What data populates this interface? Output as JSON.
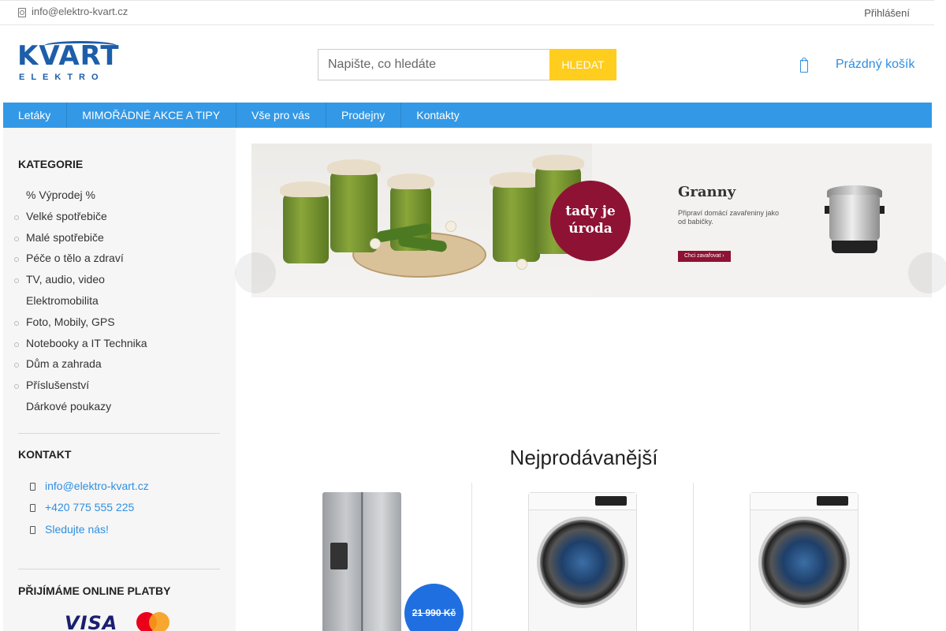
{
  "topbar": {
    "email": "info@elektro-kvart.cz",
    "login": "Přihlášení"
  },
  "logo": {
    "word": "KVART",
    "sub": "ELEKTRO"
  },
  "search": {
    "placeholder": "Napište, co hledáte",
    "button": "HLEDAT"
  },
  "cart": {
    "label": "Prázdný košík"
  },
  "nav": {
    "items": [
      "Letáky",
      "MIMOŘÁDNÉ AKCE A TIPY",
      "Vše pro vás",
      "Prodejny",
      "Kontakty"
    ]
  },
  "sidebar": {
    "categories_title": "KATEGORIE",
    "categories": [
      "% Výprodej %",
      "Velké spotřebiče",
      "Malé spotřebiče",
      "Péče o tělo a zdraví",
      "TV, audio, video",
      "Elektromobilita",
      "Foto, Mobily, GPS",
      "Notebooky a IT Technika",
      "Dům a zahrada",
      "Příslušenství",
      "Dárkové poukazy"
    ],
    "contact_title": "KONTAKT",
    "contact": {
      "email": "info@elektro-kvart.cz",
      "phone": "+420 775 555 225",
      "social": "Sledujte nás!"
    },
    "payments_title": "PŘIJÍMÁME ONLINE PLATBY",
    "payments": {
      "visa": "VISA"
    }
  },
  "banner": {
    "badge_line1": "tady je",
    "badge_line2": "úroda",
    "title": "Granny",
    "text": "Připraví domácí zavařeniny jako od babičky.",
    "button": "Chci zavařovat ›"
  },
  "bestsellers": {
    "title": "Nejprodávanější",
    "products": [
      {
        "old_price": "21 990 Kč"
      }
    ]
  },
  "colors": {
    "nav": "#3399e6",
    "search_button": "#ffcd1e",
    "link": "#2f8fe0",
    "badge": "#8e1234",
    "price_bubble": "#1f6fe0"
  }
}
